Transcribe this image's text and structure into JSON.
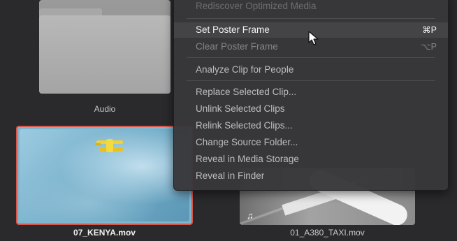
{
  "media_pool": {
    "items": [
      {
        "name": "Audio",
        "type": "folder"
      },
      {
        "name": "07_KENYA.mov",
        "type": "clip",
        "selected": true
      },
      {
        "name": "01_A380_TAXI.mov",
        "type": "clip",
        "selected": false,
        "icon": "music-note-icon"
      }
    ]
  },
  "context_menu": {
    "items": [
      {
        "label": "Rediscover Optimized Media",
        "shortcut": "",
        "state": "faded"
      },
      {
        "label": "Set Poster Frame",
        "shortcut": "⌘P",
        "state": "highlighted"
      },
      {
        "label": "Clear Poster Frame",
        "shortcut": "⌥P",
        "state": "disabled"
      },
      {
        "label": "Analyze Clip for People",
        "shortcut": "",
        "state": "enabled"
      },
      {
        "label": "Replace Selected Clip...",
        "shortcut": "",
        "state": "enabled"
      },
      {
        "label": "Unlink Selected Clips",
        "shortcut": "",
        "state": "enabled"
      },
      {
        "label": "Relink Selected Clips...",
        "shortcut": "",
        "state": "enabled"
      },
      {
        "label": "Change Source Folder...",
        "shortcut": "",
        "state": "enabled"
      },
      {
        "label": "Reveal in Media Storage",
        "shortcut": "",
        "state": "enabled"
      },
      {
        "label": "Reveal in Finder",
        "shortcut": "",
        "state": "enabled"
      }
    ]
  },
  "colors": {
    "selection_border": "#d9564a",
    "menu_background": "#38383a",
    "highlight_row": "#444447"
  }
}
